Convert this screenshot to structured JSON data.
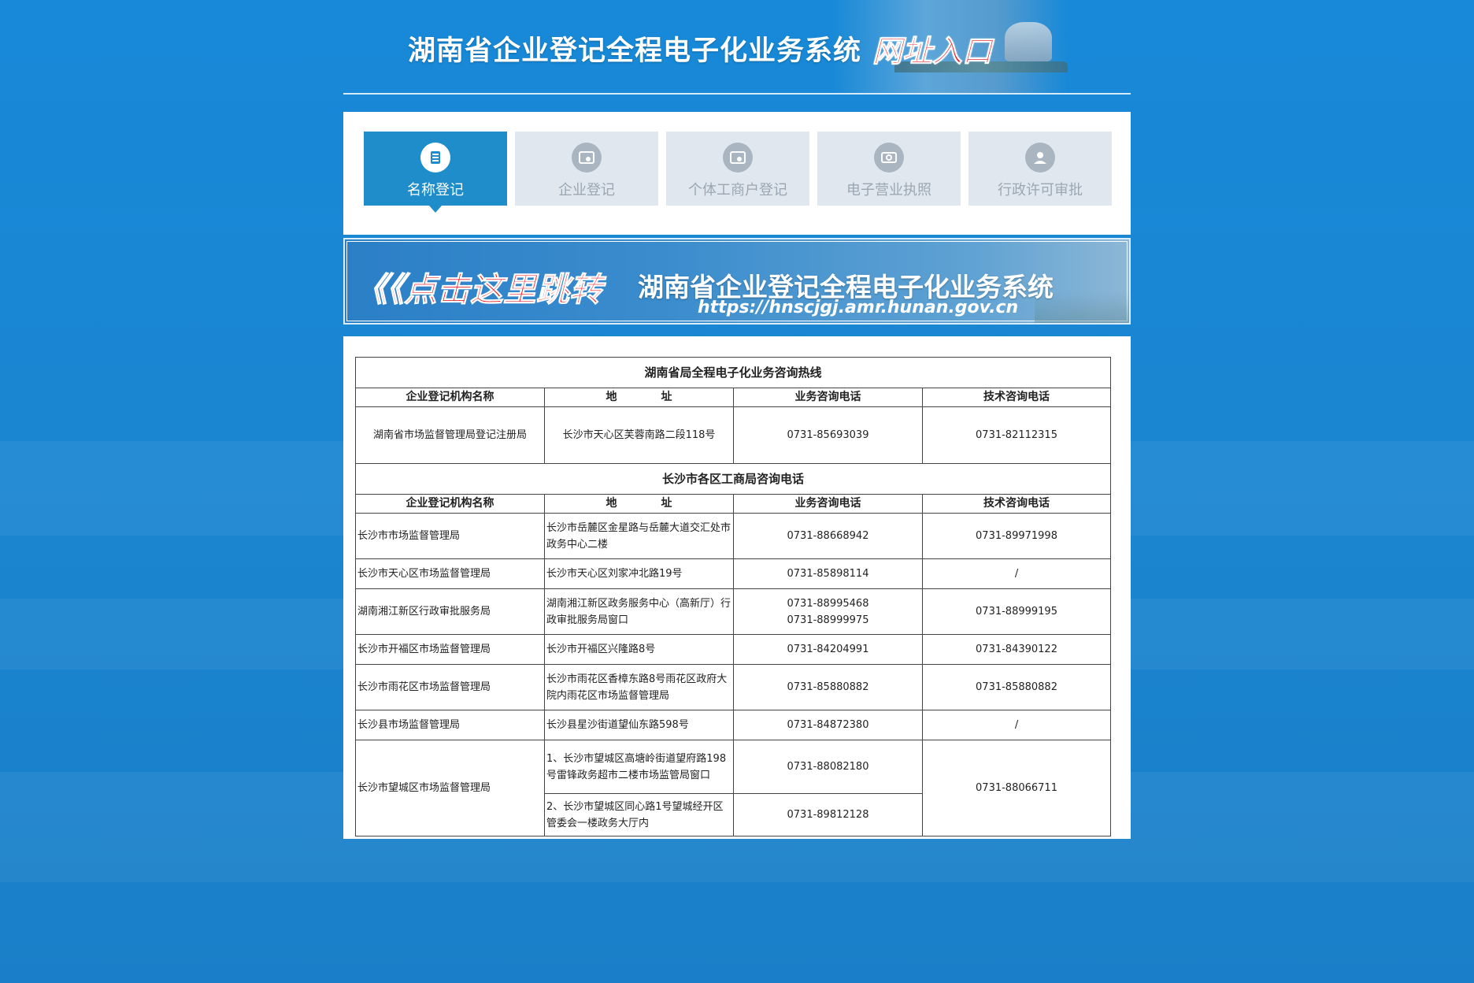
{
  "header": {
    "title": "湖南省企业登记全程电子化业务系统",
    "entry_label": "网址入口"
  },
  "tabs": [
    {
      "label": "名称登记",
      "active": true,
      "icon": "list-icon"
    },
    {
      "label": "企业登记",
      "active": false,
      "icon": "id-card-icon"
    },
    {
      "label": "个体工商户登记",
      "active": false,
      "icon": "id-card-icon"
    },
    {
      "label": "电子营业执照",
      "active": false,
      "icon": "license-icon"
    },
    {
      "label": "行政许可审批",
      "active": false,
      "icon": "user-icon"
    }
  ],
  "banner": {
    "link_text": "《《点击这里跳转",
    "title": "湖南省企业登记全程电子化业务系统",
    "url": "https://hnscjgj.amr.hunan.gov.cn"
  },
  "table": {
    "provincial": {
      "title": "湖南省局全程电子化业务咨询热线",
      "headers": [
        "企业登记机构名称",
        "地　　　　址",
        "业务咨询电话",
        "技术咨询电话"
      ],
      "rows": [
        {
          "name": "湖南省市场监督管理局登记注册局",
          "address": "长沙市天心区芙蓉南路二段118号",
          "business_phone": "0731-85693039",
          "tech_phone": "0731-82112315"
        }
      ]
    },
    "districts": {
      "title": "长沙市各区工商局咨询电话",
      "headers": [
        "企业登记机构名称",
        "地　　　　址",
        "业务咨询电话",
        "技术咨询电话"
      ],
      "rows": [
        {
          "name": "长沙市市场监督管理局",
          "address": "长沙市岳麓区金星路与岳麓大道交汇处市政务中心二楼",
          "business_phone": "0731-88668942",
          "tech_phone": "0731-89971998"
        },
        {
          "name": "长沙市天心区市场监督管理局",
          "address": "长沙市天心区刘家冲北路19号",
          "business_phone": "0731-85898114",
          "tech_phone": "/"
        },
        {
          "name": "湖南湘江新区行政审批服务局",
          "address": "湖南湘江新区政务服务中心（高新厅）行政审批服务局窗口",
          "business_phone": "0731-88995468",
          "business_phone_2": "0731-88999975",
          "tech_phone": "0731-88999195"
        },
        {
          "name": "长沙市开福区市场监督管理局",
          "address": "长沙市开福区兴隆路8号",
          "business_phone": "0731-84204991",
          "tech_phone": "0731-84390122"
        },
        {
          "name": "长沙市雨花区市场监督管理局",
          "address": "长沙市雨花区香樟东路8号雨花区政府大院内雨花区市场监督管理局",
          "business_phone": "0731-85880882",
          "tech_phone": "0731-85880882"
        },
        {
          "name": "长沙县市场监督管理局",
          "address": "长沙县星沙街道望仙东路598号",
          "business_phone": "0731-84872380",
          "tech_phone": "/"
        }
      ],
      "wangcheng": {
        "name": "长沙市望城区市场监督管理局",
        "address_1": "1、长沙市望城区高塘岭街道望府路198号雷锋政务超市二楼市场监管局窗口",
        "business_phone_1": "0731-88082180",
        "address_2": "2、长沙市望城区同心路1号望城经开区管委会一楼政务大厅内",
        "business_phone_2": "0731-89812128",
        "tech_phone": "0731-88066711"
      }
    }
  },
  "colors": {
    "page_background": "#1a86d4",
    "tab_active": "#1f8dc9",
    "tab_inactive": "#e1e7ee",
    "accent_red": "#e8202a"
  }
}
